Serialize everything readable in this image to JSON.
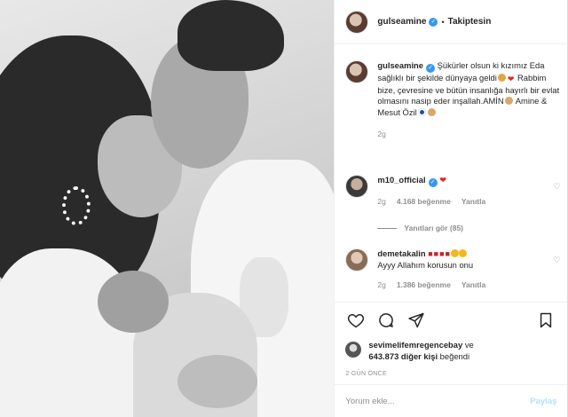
{
  "header": {
    "username": "gulseamine",
    "separator": "•",
    "follow_status": "Takiptesin"
  },
  "caption": {
    "username": "gulseamine",
    "text_1": "Şükürler olsun ki kızımız Eda sağlıklı bir şekilde dünyaya geldi",
    "text_2": "Rabbim bize, çevresine ve bütün insanlığa hayırlı bir evlat olmasını nasip eder inşallah.AMİN",
    "text_3": "Amine & Mesut Özil",
    "time": "2g"
  },
  "comments": [
    {
      "username": "m10_official",
      "text": "❤",
      "time": "2g",
      "likes": "4.168 beğenme",
      "reply_label": "Yanıtla",
      "view_replies": "Yanıtları gör (85)"
    },
    {
      "username": "demetakalin",
      "text": "Ayyy Allahım korusun onu",
      "time": "2g",
      "likes": "1.386 beğenme",
      "reply_label": "Yanıtla"
    }
  ],
  "liked_by": {
    "user": "sevimelifemregencebay",
    "connector": "ve",
    "count": "643.873 diğer kişi",
    "suffix": "beğendi"
  },
  "timestamp": "2 GÜN ÖNCE",
  "comment_box": {
    "placeholder": "Yorum ekle...",
    "post_label": "Paylaş"
  },
  "icons": {
    "like": "heart-icon",
    "comment": "comment-icon",
    "share": "share-icon",
    "save": "bookmark-icon",
    "verified": "verified-badge-icon"
  },
  "colors": {
    "verified": "#3897f0",
    "secondary_text": "#8e8e8e",
    "post_button_disabled": "#b2dffc",
    "heart": "#ed2020"
  }
}
